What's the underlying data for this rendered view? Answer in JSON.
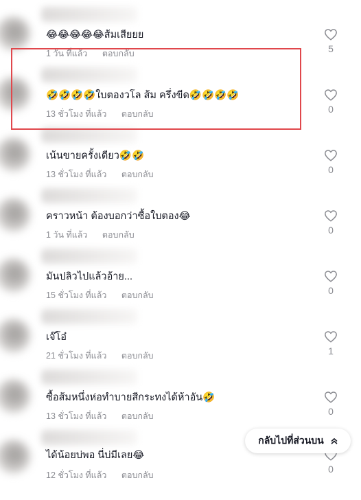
{
  "comments": [
    {
      "text": "😂😂😂😂😂ส้มเสียยย",
      "time": "1 วัน ที่แล้ว",
      "reply": "ตอบกลับ",
      "likes": "5"
    },
    {
      "text": "🤣🤣🤣🤣ใบตองวโล ส้ม ครึ่งขีด🤣🤣🤣🤣",
      "time": "13 ชั่วโมง ที่แล้ว",
      "reply": "ตอบกลับ",
      "likes": "0"
    },
    {
      "text": "เน้นขายครั้งเดียว🤣🤣",
      "time": "13 ชั่วโมง ที่แล้ว",
      "reply": "ตอบกลับ",
      "likes": "0"
    },
    {
      "text": "คราวหน้า ต้องบอกว่าซื้อใบตอง😂",
      "time": "1 วัน ที่แล้ว",
      "reply": "ตอบกลับ",
      "likes": "0"
    },
    {
      "text": "มันปลิวไปแล้วอ้าย...",
      "time": "15 ชั่วโมง ที่แล้ว",
      "reply": "ตอบกลับ",
      "likes": "0"
    },
    {
      "text": "เจ๊โอ๋",
      "time": "21 ชั่วโมง ที่แล้ว",
      "reply": "ตอบกลับ",
      "likes": "1"
    },
    {
      "text": "ซื้อส้มหนึ่งห่อทำบายสีกระทงได้ห้าอัน🤣",
      "time": "13 ชั่วโมง ที่แล้ว",
      "reply": "ตอบกลับ",
      "likes": "0"
    },
    {
      "text": "ได้น้อยบ่พอ นี่บ่มีเลย😂",
      "time": "12 ชั่วโมง ที่แล้ว",
      "reply": "ตอบกลับ",
      "likes": "0"
    }
  ],
  "back_to_top": {
    "label": "กลับไปที่ส่วนบน",
    "icon": "double-chevron-up-icon"
  },
  "colors": {
    "highlight": "#e0474c",
    "meta": "#8a8b91",
    "text": "#161823"
  }
}
